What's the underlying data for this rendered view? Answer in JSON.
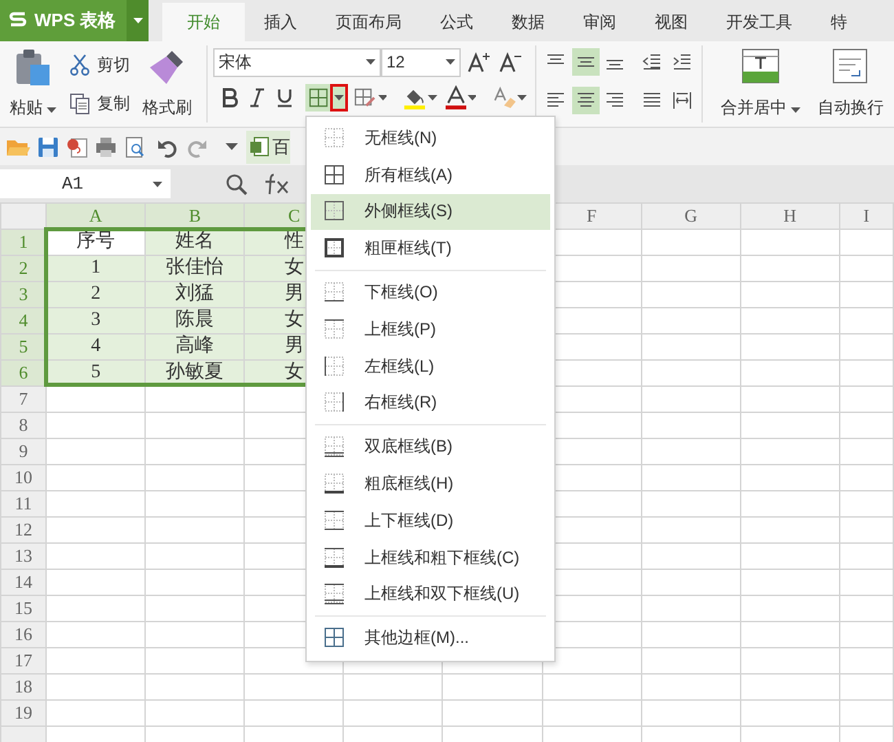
{
  "app": {
    "title": "WPS 表格"
  },
  "tabs": [
    {
      "label": "开始",
      "selected": true
    },
    {
      "label": "插入",
      "selected": false
    },
    {
      "label": "页面布局",
      "selected": false
    },
    {
      "label": "公式",
      "selected": false
    },
    {
      "label": "数据",
      "selected": false
    },
    {
      "label": "审阅",
      "selected": false
    },
    {
      "label": "视图",
      "selected": false
    },
    {
      "label": "开发工具",
      "selected": false
    },
    {
      "label": "特",
      "selected": false
    }
  ],
  "ribbon": {
    "paste": "粘贴",
    "cut": "剪切",
    "copy": "复制",
    "format_painter": "格式刷",
    "font_name": "宋体",
    "font_size": "12",
    "border_button": {
      "pressed": true,
      "annotated": true
    },
    "align_top": [
      {
        "kind": "top",
        "selected": false
      },
      {
        "kind": "middle",
        "selected": true
      },
      {
        "kind": "bottom",
        "selected": false
      },
      {
        "kind": "outdent",
        "selected": false
      },
      {
        "kind": "indent",
        "selected": false
      }
    ],
    "align_bottom": [
      {
        "kind": "left",
        "selected": false
      },
      {
        "kind": "center",
        "selected": true
      },
      {
        "kind": "right",
        "selected": false
      },
      {
        "kind": "justify",
        "selected": false
      },
      {
        "kind": "distribute",
        "selected": false
      }
    ],
    "merge": "合并居中",
    "wrap": "自动换行"
  },
  "quick_bar": {
    "doc_tab": "百"
  },
  "formula_bar": {
    "name_box": "A1"
  },
  "sheet": {
    "columns_left": [
      {
        "label": "A",
        "selected": true
      },
      {
        "label": "B",
        "selected": true
      },
      {
        "label": "C",
        "selected": true
      }
    ],
    "columns_right": [
      {
        "label": "F",
        "selected": false
      },
      {
        "label": "G",
        "selected": false
      },
      {
        "label": "H",
        "selected": false
      },
      {
        "label": "I",
        "selected": false
      }
    ],
    "rows": [
      {
        "label": "1",
        "selected": true,
        "cells": [
          {
            "text": "序号",
            "active": true
          },
          {
            "text": "姓名",
            "active": false
          },
          {
            "text": "性",
            "active": false
          }
        ]
      },
      {
        "label": "2",
        "selected": true,
        "cells": [
          {
            "text": "1",
            "active": false
          },
          {
            "text": "张佳怡",
            "active": false
          },
          {
            "text": "女",
            "active": false
          }
        ]
      },
      {
        "label": "3",
        "selected": true,
        "cells": [
          {
            "text": "2",
            "active": false
          },
          {
            "text": "刘猛",
            "active": false
          },
          {
            "text": "男",
            "active": false
          }
        ]
      },
      {
        "label": "4",
        "selected": true,
        "cells": [
          {
            "text": "3",
            "active": false
          },
          {
            "text": "陈晨",
            "active": false
          },
          {
            "text": "女",
            "active": false
          }
        ]
      },
      {
        "label": "5",
        "selected": true,
        "cells": [
          {
            "text": "4",
            "active": false
          },
          {
            "text": "高峰",
            "active": false
          },
          {
            "text": "男",
            "active": false
          }
        ]
      },
      {
        "label": "6",
        "selected": true,
        "cells": [
          {
            "text": "5",
            "active": false
          },
          {
            "text": "孙敏夏",
            "active": false
          },
          {
            "text": "女",
            "active": false
          }
        ]
      },
      {
        "label": "7",
        "selected": false,
        "cells": []
      },
      {
        "label": "8",
        "selected": false,
        "cells": []
      },
      {
        "label": "9",
        "selected": false,
        "cells": []
      },
      {
        "label": "10",
        "selected": false,
        "cells": []
      },
      {
        "label": "11",
        "selected": false,
        "cells": []
      },
      {
        "label": "12",
        "selected": false,
        "cells": []
      },
      {
        "label": "13",
        "selected": false,
        "cells": []
      },
      {
        "label": "14",
        "selected": false,
        "cells": []
      },
      {
        "label": "15",
        "selected": false,
        "cells": []
      },
      {
        "label": "16",
        "selected": false,
        "cells": []
      },
      {
        "label": "17",
        "selected": false,
        "cells": []
      },
      {
        "label": "18",
        "selected": false,
        "cells": []
      },
      {
        "label": "19",
        "selected": false,
        "cells": []
      }
    ]
  },
  "border_menu": {
    "groups": [
      [
        {
          "label": "无框线(N)",
          "kind": "none",
          "selected": false
        },
        {
          "label": "所有框线(A)",
          "kind": "all",
          "selected": false
        },
        {
          "label": "外侧框线(S)",
          "kind": "outside",
          "selected": true
        },
        {
          "label": "粗匣框线(T)",
          "kind": "thick-box",
          "selected": false
        }
      ],
      [
        {
          "label": "下框线(O)",
          "kind": "bottom",
          "selected": false
        },
        {
          "label": "上框线(P)",
          "kind": "top",
          "selected": false
        },
        {
          "label": "左框线(L)",
          "kind": "left",
          "selected": false
        },
        {
          "label": "右框线(R)",
          "kind": "right",
          "selected": false
        }
      ],
      [
        {
          "label": "双底框线(B)",
          "kind": "double-bottom",
          "selected": false
        },
        {
          "label": "粗底框线(H)",
          "kind": "thick-bottom",
          "selected": false
        },
        {
          "label": "上下框线(D)",
          "kind": "top-bottom",
          "selected": false
        },
        {
          "label": "上框线和粗下框线(C)",
          "kind": "top-thick-bottom",
          "selected": false
        },
        {
          "label": "上框线和双下框线(U)",
          "kind": "top-double-bottom",
          "selected": false
        }
      ],
      [
        {
          "label": "其他边框(M)...",
          "kind": "more",
          "selected": false
        }
      ]
    ]
  }
}
